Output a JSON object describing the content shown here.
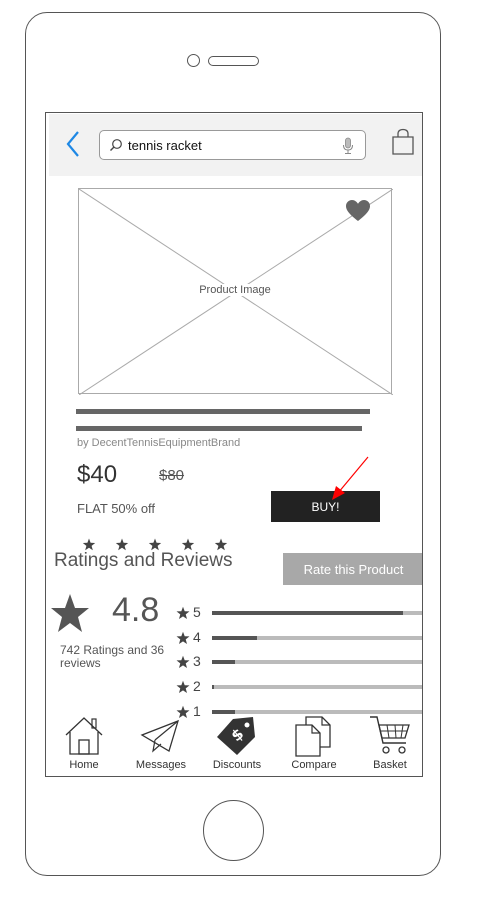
{
  "search": {
    "query": "tennis racket"
  },
  "product": {
    "image_label": "Product Image",
    "brand": "by DecentTennisEquipmentBrand",
    "price": "$40",
    "old_price": "$80",
    "discount": "FLAT 50% off",
    "buy_label": "BUY!"
  },
  "ratings": {
    "title": "Ratings and Reviews",
    "rate_button": "Rate this Product",
    "average": "4.8",
    "summary": "742 Ratings and 36 reviews",
    "star_rating_shown": 5,
    "distribution": [
      {
        "stars": "5",
        "fraction": 0.9
      },
      {
        "stars": "4",
        "fraction": 0.21
      },
      {
        "stars": "3",
        "fraction": 0.11
      },
      {
        "stars": "2",
        "fraction": 0.01
      },
      {
        "stars": "1",
        "fraction": 0.11
      }
    ]
  },
  "nav": {
    "items": [
      {
        "label": "Home",
        "icon": "home-icon"
      },
      {
        "label": "Messages",
        "icon": "paper-plane-icon"
      },
      {
        "label": "Discounts",
        "icon": "price-tag-icon"
      },
      {
        "label": "Compare",
        "icon": "documents-icon"
      },
      {
        "label": "Basket",
        "icon": "cart-icon"
      }
    ]
  },
  "colors": {
    "accent": "#1e88e5",
    "annotation_arrow": "#ff0000",
    "buy_button": "#222222",
    "rate_button": "#a8a8a8"
  }
}
